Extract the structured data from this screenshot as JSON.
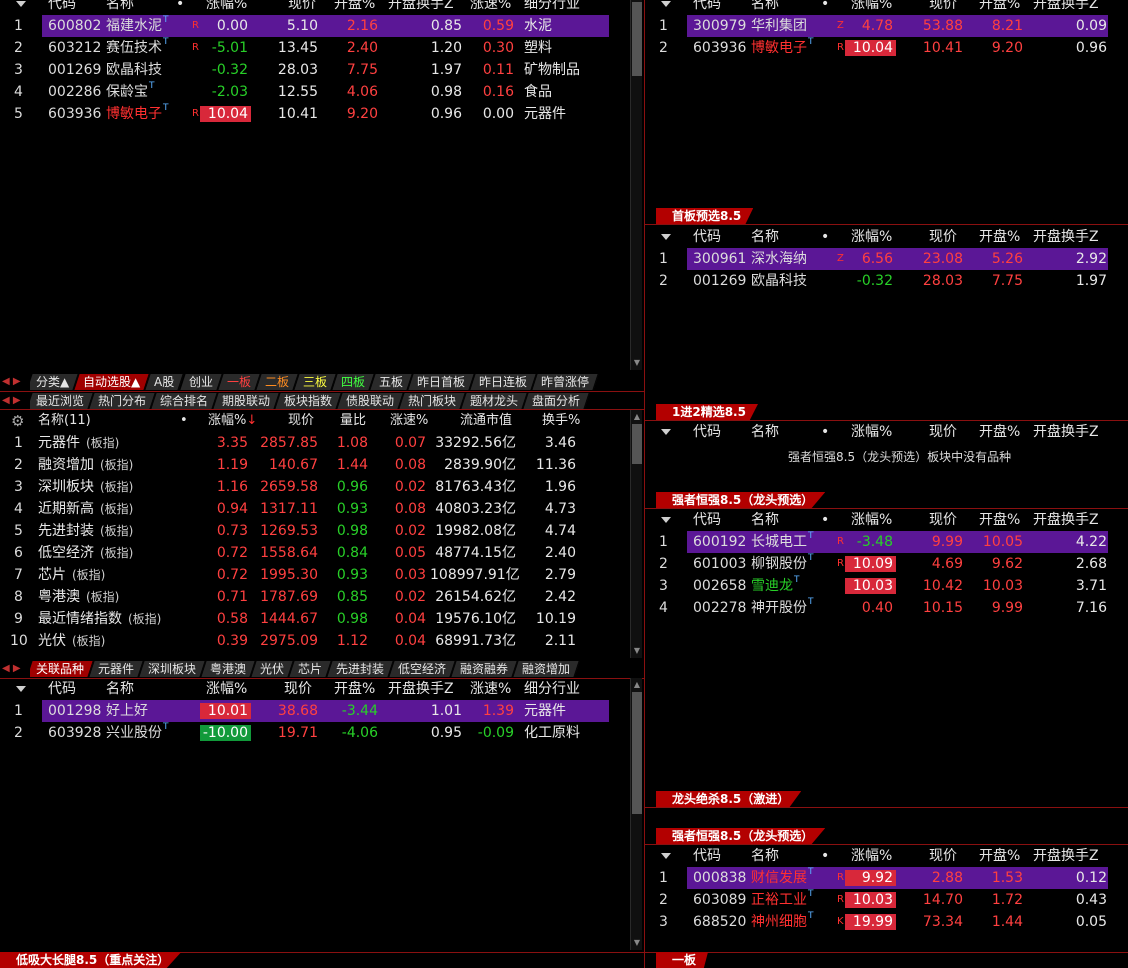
{
  "left_top": {
    "headers": {
      "code": "代码",
      "name": "名称",
      "dot": "•",
      "chg": "涨幅%",
      "price": "现价",
      "open": "开盘%",
      "open_turn": "开盘换手Z",
      "speed": "涨速%",
      "industry": "细分行业"
    },
    "rows": [
      {
        "idx": "1",
        "code": "600802",
        "name": "福建水泥",
        "mark": "R",
        "chg": "0.00",
        "price": "5.10",
        "open": "2.16",
        "open_turn": "0.85",
        "speed": "0.59",
        "industry": "水泥"
      },
      {
        "idx": "2",
        "code": "603212",
        "name": "赛伍技术",
        "mark": "R",
        "chg": "-5.01",
        "price": "13.45",
        "open": "2.40",
        "open_turn": "1.20",
        "speed": "0.30",
        "industry": "塑料"
      },
      {
        "idx": "3",
        "code": "001269",
        "name": "欧晶科技",
        "mark": "",
        "chg": "-0.32",
        "price": "28.03",
        "open": "7.75",
        "open_turn": "1.97",
        "speed": "0.11",
        "industry": "矿物制品"
      },
      {
        "idx": "4",
        "code": "002286",
        "name": "保龄宝",
        "mark": "",
        "chg": "-2.03",
        "price": "12.55",
        "open": "4.06",
        "open_turn": "0.98",
        "speed": "0.16",
        "industry": "食品"
      },
      {
        "idx": "5",
        "code": "603936",
        "name": "博敏电子",
        "mark": "R",
        "chg": "10.04",
        "price": "10.41",
        "open": "9.20",
        "open_turn": "0.96",
        "speed": "0.00",
        "industry": "元器件"
      }
    ]
  },
  "tabs_row1": [
    "分类▲",
    "自动选股▲",
    "A股",
    "创业",
    "一板",
    "二板",
    "三板",
    "四板",
    "五板",
    "昨日首板",
    "昨日连板",
    "昨曾涨停"
  ],
  "tabs_row2": [
    "最近浏览",
    "热门分布",
    "综合排名",
    "期股联动",
    "板块指数",
    "债股联动",
    "热门板块",
    "题材龙头",
    "盘面分析"
  ],
  "sector": {
    "headers": {
      "name": "名称(11)",
      "dot": "•",
      "chg": "涨幅%",
      "sort": "↓",
      "price": "现价",
      "ratio": "量比",
      "speed": "涨速%",
      "cap": "流通市值",
      "turn": "换手%"
    },
    "rows": [
      {
        "idx": "1",
        "name": "元器件",
        "tag": "(板指)",
        "chg": "3.35",
        "price": "2857.85",
        "ratio": "1.08",
        "speed": "0.07",
        "cap": "33292.56亿",
        "turn": "3.46"
      },
      {
        "idx": "2",
        "name": "融资增加",
        "tag": "(板指)",
        "chg": "1.19",
        "price": "140.67",
        "ratio": "1.44",
        "speed": "0.08",
        "cap": "2839.90亿",
        "turn": "11.36"
      },
      {
        "idx": "3",
        "name": "深圳板块",
        "tag": "(板指)",
        "chg": "1.16",
        "price": "2659.58",
        "ratio": "0.96",
        "speed": "0.02",
        "cap": "81763.43亿",
        "turn": "1.96"
      },
      {
        "idx": "4",
        "name": "近期新高",
        "tag": "(板指)",
        "chg": "0.94",
        "price": "1317.11",
        "ratio": "0.93",
        "speed": "0.08",
        "cap": "40803.23亿",
        "turn": "4.73"
      },
      {
        "idx": "5",
        "name": "先进封装",
        "tag": "(板指)",
        "chg": "0.73",
        "price": "1269.53",
        "ratio": "0.98",
        "speed": "0.02",
        "cap": "19982.08亿",
        "turn": "4.74"
      },
      {
        "idx": "6",
        "name": "低空经济",
        "tag": "(板指)",
        "chg": "0.72",
        "price": "1558.64",
        "ratio": "0.84",
        "speed": "0.05",
        "cap": "48774.15亿",
        "turn": "2.40"
      },
      {
        "idx": "7",
        "name": "芯片",
        "tag": "(板指)",
        "chg": "0.72",
        "price": "1995.30",
        "ratio": "0.93",
        "speed": "0.03",
        "cap": "108997.91亿",
        "turn": "2.79"
      },
      {
        "idx": "8",
        "name": "粤港澳",
        "tag": "(板指)",
        "chg": "0.71",
        "price": "1787.69",
        "ratio": "0.85",
        "speed": "0.02",
        "cap": "26154.62亿",
        "turn": "2.42"
      },
      {
        "idx": "9",
        "name": "最近情绪指数",
        "tag": "(板指)",
        "chg": "0.58",
        "price": "1444.67",
        "ratio": "0.98",
        "speed": "0.04",
        "cap": "19576.10亿",
        "turn": "10.19"
      },
      {
        "idx": "10",
        "name": "光伏",
        "tag": "(板指)",
        "chg": "0.39",
        "price": "2975.09",
        "ratio": "1.12",
        "speed": "0.04",
        "cap": "68991.73亿",
        "turn": "2.11"
      }
    ]
  },
  "tabs_row3": [
    "关联品种",
    "元器件",
    "深圳板块",
    "粤港澳",
    "光伏",
    "芯片",
    "先进封装",
    "低空经济",
    "融资融券",
    "融资增加"
  ],
  "related": {
    "headers": {
      "code": "代码",
      "name": "名称",
      "chg": "涨幅%",
      "price": "现价",
      "open": "开盘%",
      "open_turn": "开盘换手Z",
      "speed": "涨速%",
      "industry": "细分行业"
    },
    "rows": [
      {
        "idx": "1",
        "code": "001298",
        "name": "好上好",
        "chg": "10.01",
        "price": "38.68",
        "open": "-3.44",
        "open_turn": "1.01",
        "speed": "1.39",
        "industry": "元器件"
      },
      {
        "idx": "2",
        "code": "603928",
        "name": "兴业股份",
        "chg": "-10.00",
        "price": "19.71",
        "open": "-4.06",
        "open_turn": "0.95",
        "speed": "-0.09",
        "industry": "化工原料"
      }
    ]
  },
  "bottom_left_tab": "低吸大长腿8.5（重点关注）",
  "right": {
    "headers": {
      "code": "代码",
      "name": "名称",
      "dot": "•",
      "chg": "涨幅%",
      "price": "现价",
      "open": "开盘%",
      "open_turn": "开盘换手Z"
    },
    "p1": {
      "rows": [
        {
          "idx": "1",
          "code": "300979",
          "name": "华利集团",
          "mark": "Z",
          "chg": "4.78",
          "price": "53.88",
          "open": "8.21",
          "open_turn": "0.09"
        },
        {
          "idx": "2",
          "code": "603936",
          "name": "博敏电子",
          "mark": "R",
          "chg": "10.04",
          "price": "10.41",
          "open": "9.20",
          "open_turn": "0.96"
        }
      ]
    },
    "p1_tab": "首板预选8.5",
    "p2": {
      "rows": [
        {
          "idx": "1",
          "code": "300961",
          "name": "深水海纳",
          "mark": "Z",
          "chg": "6.56",
          "price": "23.08",
          "open": "5.26",
          "open_turn": "2.92"
        },
        {
          "idx": "2",
          "code": "001269",
          "name": "欧晶科技",
          "mark": "",
          "chg": "-0.32",
          "price": "28.03",
          "open": "7.75",
          "open_turn": "1.97"
        }
      ]
    },
    "p2_tab": "1进2精选8.5",
    "p3_msg": "强者恒强8.5（龙头预选）板块中没有品种",
    "p3_tab": "强者恒强8.5（龙头预选）",
    "p4": {
      "rows": [
        {
          "idx": "1",
          "code": "600192",
          "name": "长城电工",
          "mark": "R",
          "chg": "-3.48",
          "price": "9.99",
          "open": "10.05",
          "open_turn": "4.22"
        },
        {
          "idx": "2",
          "code": "601003",
          "name": "柳钢股份",
          "mark": "R",
          "chg": "10.09",
          "price": "4.69",
          "open": "9.62",
          "open_turn": "2.68"
        },
        {
          "idx": "3",
          "code": "002658",
          "name": "雪迪龙",
          "mark": "",
          "chg": "10.03",
          "price": "10.42",
          "open": "10.03",
          "open_turn": "3.71"
        },
        {
          "idx": "4",
          "code": "002278",
          "name": "神开股份",
          "mark": "",
          "chg": "0.40",
          "price": "10.15",
          "open": "9.99",
          "open_turn": "7.16"
        }
      ]
    },
    "p4_tab": "龙头绝杀8.5（激进）",
    "p5_tab": "强者恒强8.5（龙头预选）",
    "p5": {
      "rows": [
        {
          "idx": "1",
          "code": "000838",
          "name": "财信发展",
          "mark": "R",
          "chg": "9.92",
          "price": "2.88",
          "open": "1.53",
          "open_turn": "0.12"
        },
        {
          "idx": "2",
          "code": "603089",
          "name": "正裕工业",
          "mark": "R",
          "chg": "10.03",
          "price": "14.70",
          "open": "1.72",
          "open_turn": "0.43"
        },
        {
          "idx": "3",
          "code": "688520",
          "name": "神州细胞",
          "mark": "K",
          "chg": "19.99",
          "price": "73.34",
          "open": "1.44",
          "open_turn": "0.05"
        }
      ]
    },
    "p5_bottom_tab": "一板"
  },
  "colors": {
    "selected_row": "#5b1796",
    "up": "#ff4040",
    "down": "#28d028",
    "divider": "#8a1010",
    "tab_red": "#b30000"
  }
}
